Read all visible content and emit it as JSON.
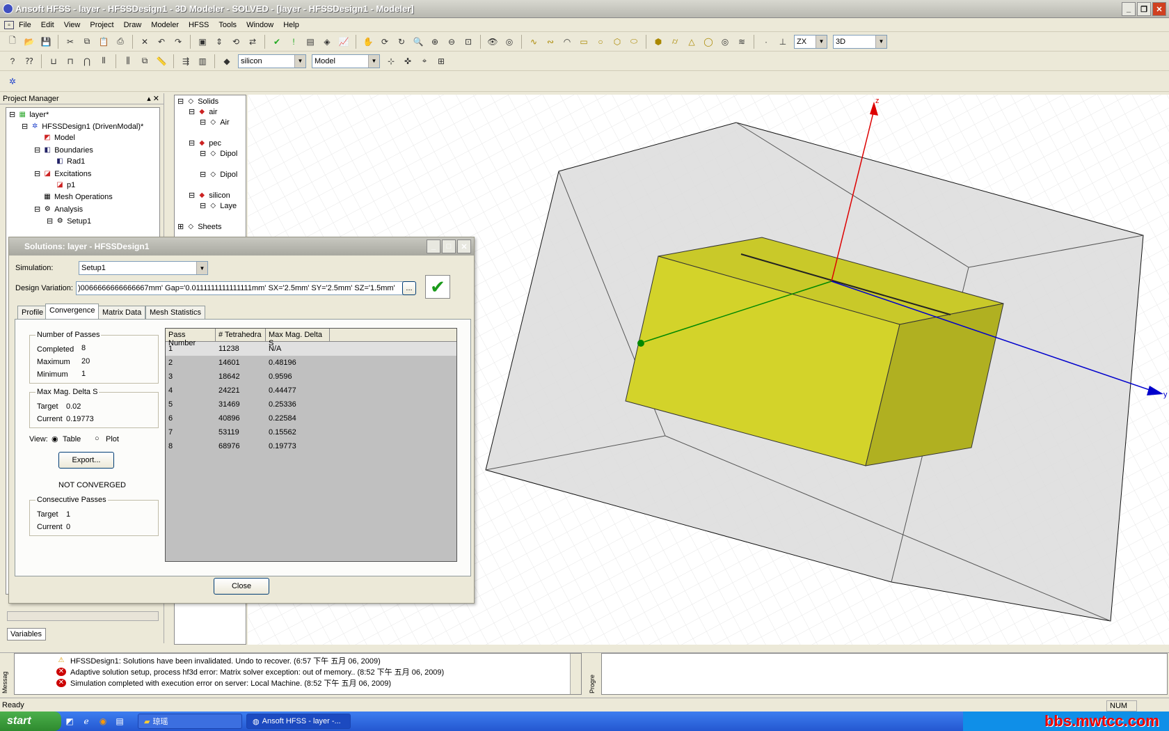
{
  "window": {
    "title": "Ansoft HFSS  - layer - HFSSDesign1 - 3D Modeler - SOLVED - [layer - HFSSDesign1 - Modeler]"
  },
  "menu": [
    "File",
    "Edit",
    "View",
    "Project",
    "Draw",
    "Modeler",
    "HFSS",
    "Tools",
    "Window",
    "Help"
  ],
  "toolbar": {
    "view_plane": "ZX",
    "view_mode": "3D",
    "material": "silicon",
    "model_mode": "Model"
  },
  "project_manager": {
    "header": "Project Manager",
    "tree": [
      "layer*",
      "HFSSDesign1 (DrivenModal)*",
      "Model",
      "Boundaries",
      "Rad1",
      "Excitations",
      "p1",
      "Mesh Operations",
      "Analysis",
      "Setup1"
    ],
    "variables_tab": "Variables"
  },
  "model_tree": [
    "Solids",
    "air",
    "Air",
    "pec",
    "Dipol",
    "Dipol",
    "silicon",
    "Laye",
    "Sheets"
  ],
  "viewport": {
    "axis_z": "z",
    "axis_y": "y"
  },
  "dialog": {
    "title": "Solutions: layer - HFSSDesign1",
    "simulation_label": "Simulation:",
    "simulation_value": "Setup1",
    "design_variation_label": "Design Variation:",
    "design_variation_value": ")0066666666666667mm' Gap='0.0111111111111111mm' SX='2.5mm' SY='2.5mm' SZ='1.5mm'",
    "browse": "...",
    "tabs": [
      "Profile",
      "Convergence",
      "Matrix Data",
      "Mesh Statistics"
    ],
    "passes": {
      "title": "Number of Passes",
      "completed_label": "Completed",
      "completed": "8",
      "maximum_label": "Maximum",
      "maximum": "20",
      "minimum_label": "Minimum",
      "minimum": "1"
    },
    "delta": {
      "title": "Max Mag. Delta S",
      "target_label": "Target",
      "target": "0.02",
      "current_label": "Current",
      "current": "0.19773"
    },
    "view_label": "View:",
    "view_table": "Table",
    "view_plot": "Plot",
    "export": "Export...",
    "status": "NOT CONVERGED",
    "consecutive": {
      "title": "Consecutive Passes",
      "target_label": "Target",
      "target": "1",
      "current_label": "Current",
      "current": "0"
    },
    "table_headers": [
      "Pass Number",
      "# Tetrahedra",
      "Max Mag. Delta S"
    ],
    "rows": [
      [
        "1",
        "11238",
        "N/A"
      ],
      [
        "2",
        "14601",
        "0.48196"
      ],
      [
        "3",
        "18642",
        "0.9596"
      ],
      [
        "4",
        "24221",
        "0.44477"
      ],
      [
        "5",
        "31469",
        "0.25336"
      ],
      [
        "6",
        "40896",
        "0.22584"
      ],
      [
        "7",
        "53119",
        "0.15562"
      ],
      [
        "8",
        "68976",
        "0.19773"
      ]
    ],
    "close": "Close"
  },
  "messages": [
    {
      "type": "warning",
      "text": "HFSSDesign1: Solutions have been invalidated. Undo to recover. (6:57 下午  五月 06, 2009)"
    },
    {
      "type": "error",
      "text": "Adaptive solution setup, process hf3d error: Matrix solver exception: out of memory.. (8:52 下午  五月 06, 2009)"
    },
    {
      "type": "error",
      "text": "Simulation completed with execution error on server: Local Machine. (8:52 下午  五月 06, 2009)"
    }
  ],
  "message_tab": "Messag",
  "progress_tab": "Progre",
  "status": {
    "text": "Ready",
    "num": "NUM"
  },
  "taskbar": {
    "start": "start",
    "folder": "琼瑶",
    "app": "Ansoft HFSS  - layer -...",
    "watermark": "bbs.mwtcc.com"
  }
}
